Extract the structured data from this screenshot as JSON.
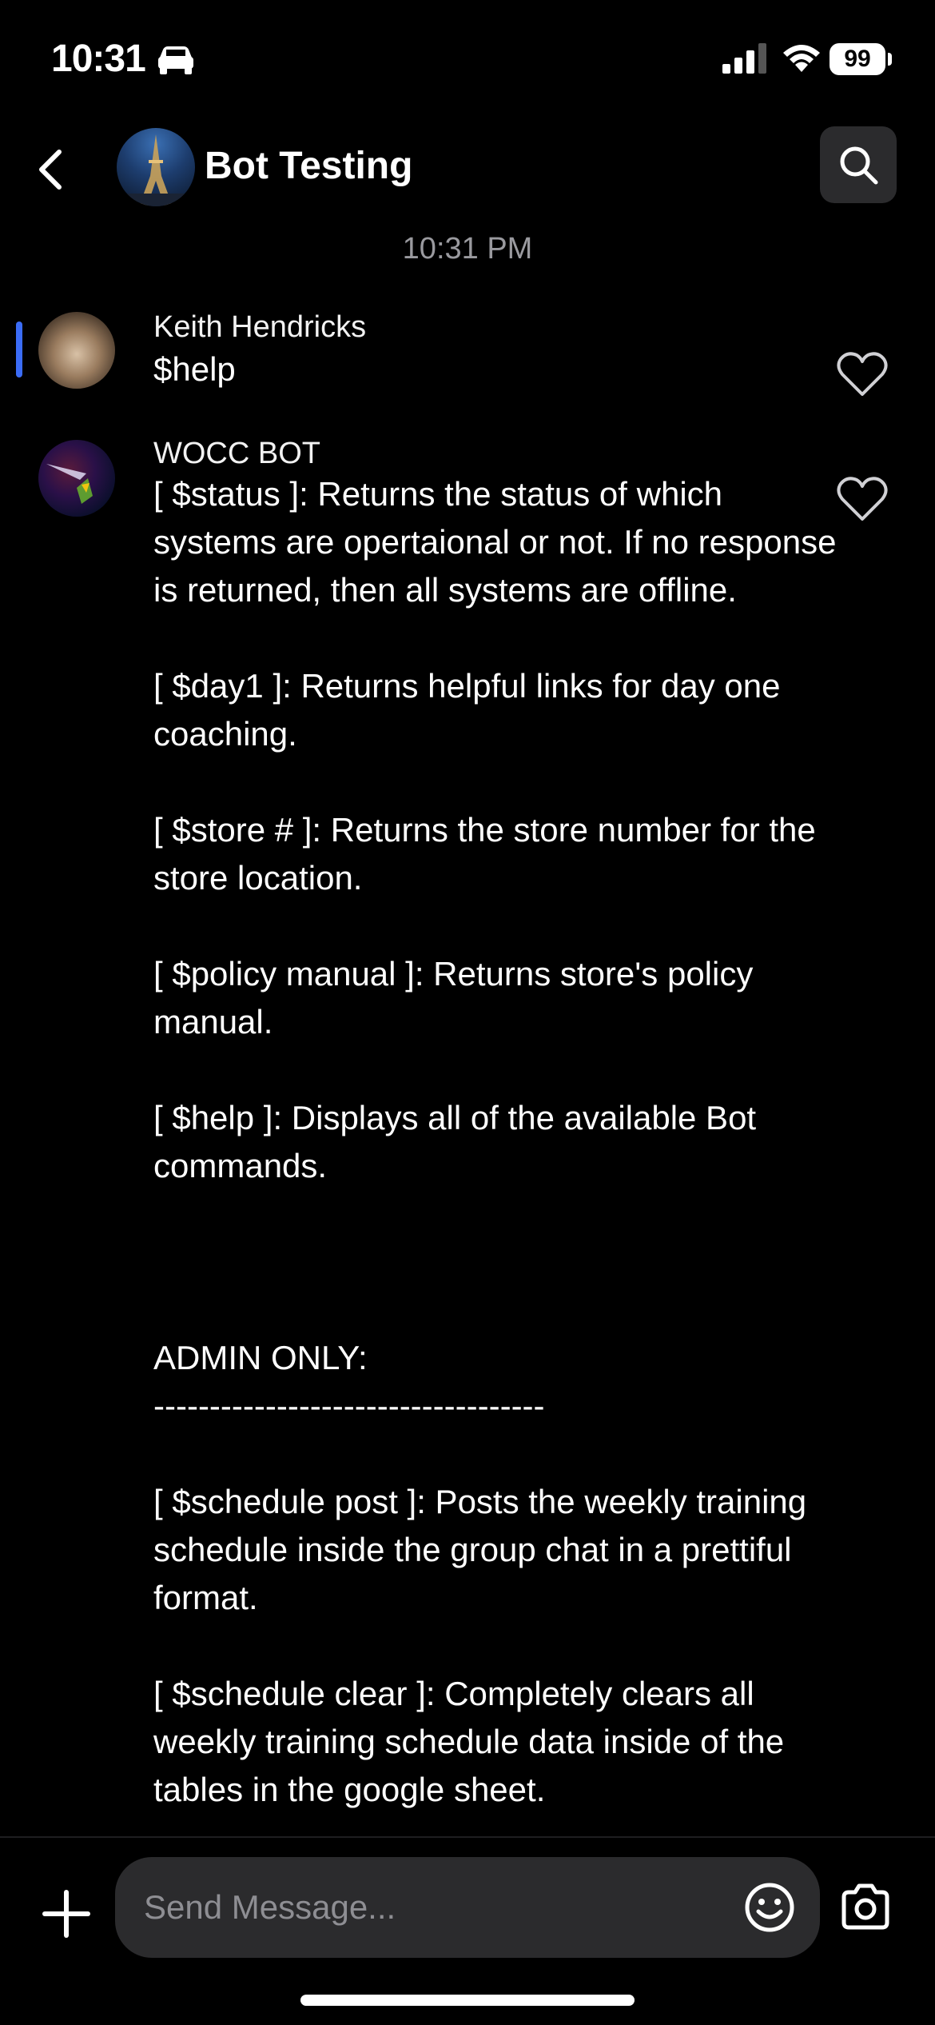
{
  "status_bar": {
    "time": "10:31",
    "battery": "99"
  },
  "header": {
    "title": "Bot Testing",
    "timestamp": "10:31 PM"
  },
  "messages": [
    {
      "sender": "Keith Hendricks",
      "text": "$help"
    },
    {
      "sender": "WOCC BOT",
      "text": "[ $status ]: Returns the status of which systems are opertaional or not. If no response is returned, then all systems are offline.\n\n[ $day1 ]: Returns helpful links for day one coaching.\n\n[ $store # ]: Returns the store number for the store location.\n\n[ $policy manual ]: Returns store's policy manual.\n\n[ $help ]: Displays all of the available Bot commands.\n\n\n\nADMIN ONLY:\n-----------------------------------\n\n[ $schedule post ]: Posts the weekly training schedule inside the group chat in a prettiful format.\n\n[ $schedule clear ]: Completely clears all weekly training schedule data inside of the tables in the google sheet."
    }
  ],
  "composer": {
    "placeholder": "Send Message..."
  },
  "colors": {
    "accent": "#3b6cf6",
    "surface": "#2b2b2d",
    "background": "#000000"
  }
}
